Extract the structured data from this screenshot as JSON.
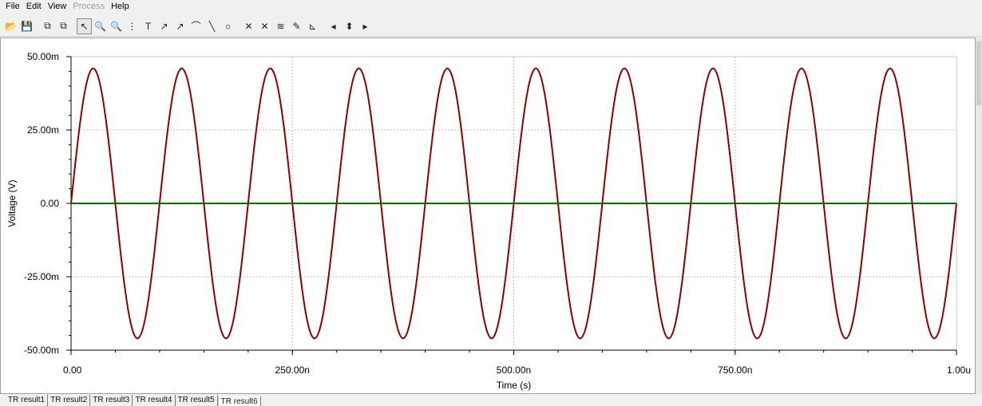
{
  "menu": [
    {
      "label": "File"
    },
    {
      "label": "Edit"
    },
    {
      "label": "View"
    },
    {
      "label": "Process",
      "disabled": true
    },
    {
      "label": "Help"
    }
  ],
  "toolbar": [
    {
      "icon": "open-folder-icon",
      "glyph": "📂"
    },
    {
      "icon": "save-icon",
      "glyph": "💾"
    },
    {
      "sep": true
    },
    {
      "icon": "copy-icon",
      "glyph": "⧉"
    },
    {
      "icon": "paste-special-icon",
      "glyph": "⧉"
    },
    {
      "sep": true
    },
    {
      "icon": "pointer-icon",
      "glyph": "↖",
      "selected": true
    },
    {
      "icon": "zoom-in-icon",
      "glyph": "🔍"
    },
    {
      "icon": "zoom-100-icon",
      "glyph": "🔍"
    },
    {
      "icon": "grid-icon",
      "glyph": "⋮"
    },
    {
      "icon": "text-icon",
      "glyph": "T"
    },
    {
      "icon": "curve-label-icon",
      "glyph": "↗"
    },
    {
      "icon": "curve-label2-icon",
      "glyph": "↗"
    },
    {
      "icon": "curve-marker-icon",
      "glyph": "⌒"
    },
    {
      "icon": "line-icon",
      "glyph": "╲"
    },
    {
      "icon": "circle-icon",
      "glyph": "○"
    },
    {
      "sep": true
    },
    {
      "icon": "cursor-a-icon",
      "glyph": "✕"
    },
    {
      "icon": "cursor-b-icon",
      "glyph": "✕"
    },
    {
      "icon": "add-curves-icon",
      "glyph": "≋"
    },
    {
      "icon": "probe-icon",
      "glyph": "✎"
    },
    {
      "icon": "arrow-tool-icon",
      "glyph": "⊾"
    },
    {
      "sep": true
    },
    {
      "icon": "left-arrow-icon",
      "glyph": "◂"
    },
    {
      "icon": "up-down-arrow-icon",
      "glyph": "⬍"
    },
    {
      "icon": "right-arrow-icon",
      "glyph": "▸"
    }
  ],
  "tabs": [
    {
      "label": "TR result1"
    },
    {
      "label": "TR result2"
    },
    {
      "label": "TR result3"
    },
    {
      "label": "TR result4"
    },
    {
      "label": "TR result5"
    },
    {
      "label": "TR result6",
      "active": true
    }
  ],
  "chart_data": {
    "type": "line",
    "xlabel": "Time (s)",
    "ylabel": "Voltage (V)",
    "xlim": [
      0,
      1e-06
    ],
    "ylim": [
      -0.05,
      0.05
    ],
    "grid": true,
    "xticks": [
      {
        "v": 0,
        "label": "0.00"
      },
      {
        "v": 2.5e-07,
        "label": "250.00n"
      },
      {
        "v": 5e-07,
        "label": "500.00n"
      },
      {
        "v": 7.5e-07,
        "label": "750.00n"
      },
      {
        "v": 1e-06,
        "label": "1.00u"
      }
    ],
    "yticks": [
      {
        "v": 0.05,
        "label": "50.00m"
      },
      {
        "v": 0.025,
        "label": "25.00m"
      },
      {
        "v": 0,
        "label": "0.00"
      },
      {
        "v": -0.025,
        "label": "-25.00m"
      },
      {
        "v": -0.05,
        "label": "-50.00m"
      }
    ],
    "series": [
      {
        "color": "#8b0000",
        "x": [
          0,
          5e-09,
          1e-08,
          1.5e-08,
          2e-08,
          2.5e-08,
          3e-08,
          3.5e-08,
          4e-08,
          4.5e-08,
          5e-08,
          5.5e-08,
          6e-08,
          6.5e-08,
          7e-08,
          7.5e-08,
          8e-08,
          8.5e-08,
          9e-08,
          9.5e-08,
          1e-07,
          1.05e-07,
          1.1e-07,
          1.15e-07,
          1.2e-07,
          1.25e-07,
          1.3e-07,
          1.35e-07,
          1.4e-07,
          1.45e-07,
          1.5e-07,
          1.55e-07,
          1.6e-07,
          1.65e-07,
          1.7e-07,
          1.75e-07,
          1.8e-07,
          1.85e-07,
          1.9e-07,
          1.95e-07,
          2e-07,
          2.05e-07,
          2.1e-07,
          2.15e-07,
          2.2e-07,
          2.25e-07,
          2.3e-07,
          2.35e-07,
          2.4e-07,
          2.45e-07,
          2.5e-07,
          2.55e-07,
          2.6e-07,
          2.65e-07,
          2.7e-07,
          2.75e-07,
          2.8e-07,
          2.85e-07,
          2.9e-07,
          2.95e-07,
          3e-07,
          3.05e-07,
          3.1e-07,
          3.15e-07,
          3.2e-07,
          3.25e-07,
          3.3e-07,
          3.35e-07,
          3.4e-07,
          3.45e-07,
          3.5e-07,
          3.55e-07,
          3.6e-07,
          3.65e-07,
          3.7e-07,
          3.75e-07,
          3.8e-07,
          3.85e-07,
          3.9e-07,
          3.95e-07,
          4e-07,
          4.05e-07,
          4.1e-07,
          4.15e-07,
          4.2e-07,
          4.25e-07,
          4.3e-07,
          4.35e-07,
          4.4e-07,
          4.45e-07,
          4.5e-07,
          4.55e-07,
          4.6e-07,
          4.65e-07,
          4.7e-07,
          4.75e-07,
          4.8e-07,
          4.85e-07,
          4.9e-07,
          4.95e-07,
          5e-07,
          5.05e-07,
          5.1e-07,
          5.15e-07,
          5.2e-07,
          5.25e-07,
          5.3e-07,
          5.35e-07,
          5.4e-07,
          5.45e-07,
          5.5e-07,
          5.55e-07,
          5.6e-07,
          5.65e-07,
          5.7e-07,
          5.75e-07,
          5.8e-07,
          5.85e-07,
          5.9e-07,
          5.95e-07,
          6e-07,
          6.05e-07,
          6.1e-07,
          6.15e-07,
          6.2e-07,
          6.25e-07,
          6.3e-07,
          6.35e-07,
          6.4e-07,
          6.45e-07,
          6.5e-07,
          6.55e-07,
          6.6e-07,
          6.65e-07,
          6.7e-07,
          6.75e-07,
          6.8e-07,
          6.85e-07,
          6.9e-07,
          6.95e-07,
          7e-07,
          7.05e-07,
          7.1e-07,
          7.15e-07,
          7.2e-07,
          7.25e-07,
          7.3e-07,
          7.35e-07,
          7.4e-07,
          7.45e-07,
          7.5e-07,
          7.55e-07,
          7.6e-07,
          7.65e-07,
          7.7e-07,
          7.75e-07,
          7.8e-07,
          7.85e-07,
          7.9e-07,
          7.95e-07,
          8e-07,
          8.05e-07,
          8.1e-07,
          8.15e-07,
          8.2e-07,
          8.25e-07,
          8.3e-07,
          8.35e-07,
          8.4e-07,
          8.45e-07,
          8.5e-07,
          8.55e-07,
          8.6e-07,
          8.65e-07,
          8.7e-07,
          8.75e-07,
          8.8e-07,
          8.85e-07,
          8.9e-07,
          8.95e-07,
          9e-07,
          9.05e-07,
          9.1e-07,
          9.15e-07,
          9.2e-07,
          9.25e-07,
          9.3e-07,
          9.35e-07,
          9.4e-07,
          9.45e-07,
          9.5e-07,
          9.55e-07,
          9.6e-07,
          9.65e-07,
          9.7e-07,
          9.75e-07,
          9.8e-07,
          9.85e-07,
          9.9e-07,
          9.95e-07,
          1e-06
        ],
        "y": [
          0,
          0.0142,
          0.027,
          0.0372,
          0.0437,
          0.046,
          0.0437,
          0.0372,
          0.027,
          0.0142,
          0,
          -0.0142,
          -0.027,
          -0.0372,
          -0.0437,
          -0.046,
          -0.0437,
          -0.0372,
          -0.027,
          -0.0142,
          0,
          0.0142,
          0.027,
          0.0372,
          0.0437,
          0.046,
          0.0437,
          0.0372,
          0.027,
          0.0142,
          0,
          -0.0142,
          -0.027,
          -0.0372,
          -0.0437,
          -0.046,
          -0.0437,
          -0.0372,
          -0.027,
          -0.0142,
          0,
          0.0142,
          0.027,
          0.0372,
          0.0437,
          0.046,
          0.0437,
          0.0372,
          0.027,
          0.0142,
          0,
          -0.0142,
          -0.027,
          -0.0372,
          -0.0437,
          -0.046,
          -0.0437,
          -0.0372,
          -0.027,
          -0.0142,
          0,
          0.0142,
          0.027,
          0.0372,
          0.0437,
          0.046,
          0.0437,
          0.0372,
          0.027,
          0.0142,
          0,
          -0.0142,
          -0.027,
          -0.0372,
          -0.0437,
          -0.046,
          -0.0437,
          -0.0372,
          -0.027,
          -0.0142,
          0,
          0.0142,
          0.027,
          0.0372,
          0.0437,
          0.046,
          0.0437,
          0.0372,
          0.027,
          0.0142,
          0,
          -0.0142,
          -0.027,
          -0.0372,
          -0.0437,
          -0.046,
          -0.0437,
          -0.0372,
          -0.027,
          -0.0142,
          0,
          0.0142,
          0.027,
          0.0372,
          0.0437,
          0.046,
          0.0437,
          0.0372,
          0.027,
          0.0142,
          0,
          -0.0142,
          -0.027,
          -0.0372,
          -0.0437,
          -0.046,
          -0.0437,
          -0.0372,
          -0.027,
          -0.0142,
          0,
          0.0142,
          0.027,
          0.0372,
          0.0437,
          0.046,
          0.0437,
          0.0372,
          0.027,
          0.0142,
          0,
          -0.0142,
          -0.027,
          -0.0372,
          -0.0437,
          -0.046,
          -0.0437,
          -0.0372,
          -0.027,
          -0.0142,
          0,
          0.0142,
          0.027,
          0.0372,
          0.0437,
          0.046,
          0.0437,
          0.0372,
          0.027,
          0.0142,
          0,
          -0.0142,
          -0.027,
          -0.0372,
          -0.0437,
          -0.046,
          -0.0437,
          -0.0372,
          -0.027,
          -0.0142,
          0,
          0.0142,
          0.027,
          0.0372,
          0.0437,
          0.046,
          0.0437,
          0.0372,
          0.027,
          0.0142,
          0,
          -0.0142,
          -0.027,
          -0.0372,
          -0.0437,
          -0.046,
          -0.0437,
          -0.0372,
          -0.027,
          -0.0142,
          0,
          0.0142,
          0.027,
          0.0372,
          0.0437,
          0.046,
          0.0437,
          0.0372,
          0.027,
          0.0142,
          0,
          -0.0142,
          -0.027,
          -0.0372,
          -0.0437,
          -0.046,
          -0.0437,
          -0.0372,
          -0.027,
          -0.0142,
          0
        ]
      },
      {
        "color": "#007000",
        "x": [
          0,
          1e-06
        ],
        "y": [
          0,
          0
        ]
      }
    ]
  }
}
